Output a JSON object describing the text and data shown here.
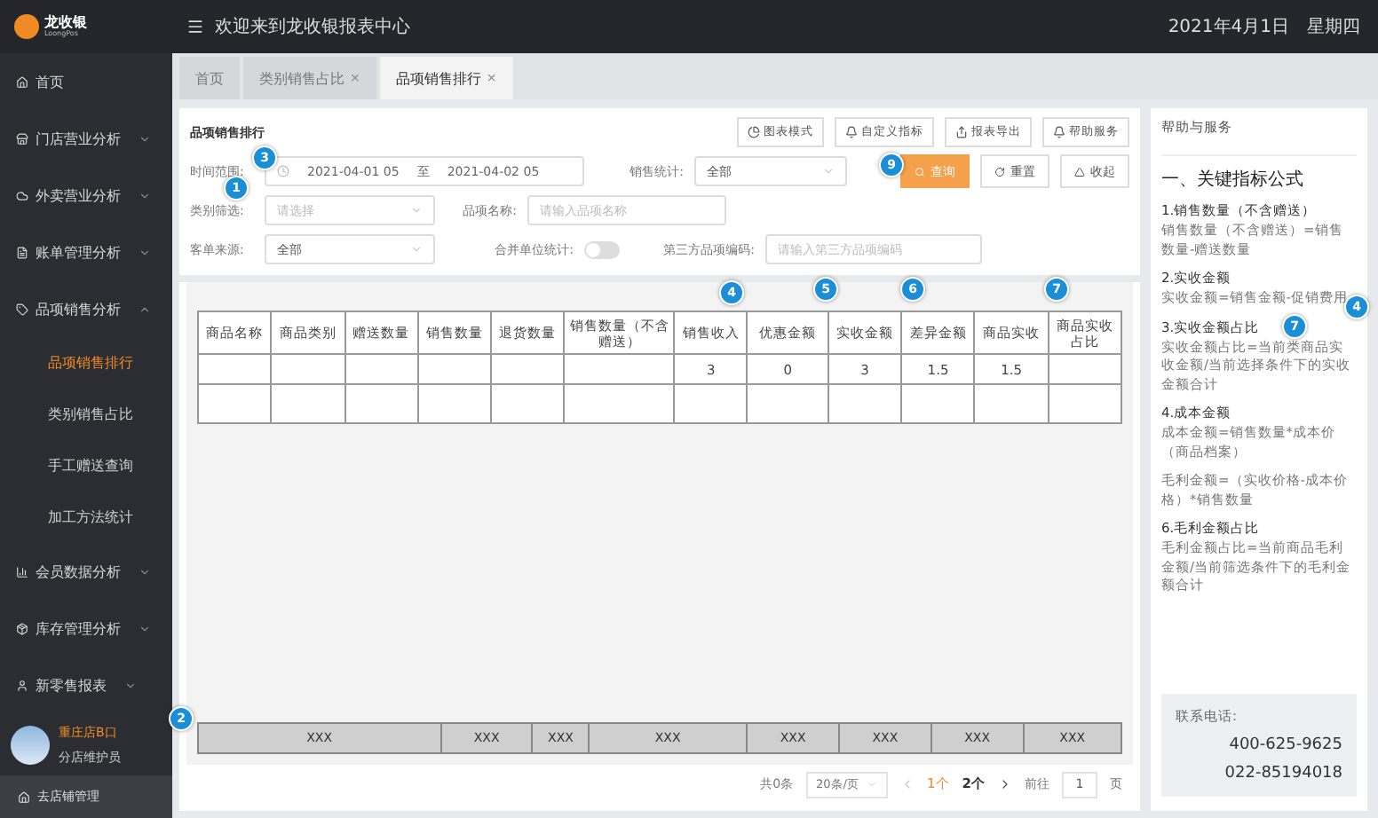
{
  "header": {
    "logo": "龙收银",
    "logo_sub": "LoongPos",
    "title": "欢迎来到龙收银报表中心",
    "date": "2021年4月1日",
    "weekday": "星期四"
  },
  "sidebar": {
    "items": [
      {
        "label": "首页"
      },
      {
        "label": "门店营业分析",
        "expanded": false
      },
      {
        "label": "外卖营业分析",
        "expanded": false
      },
      {
        "label": "账单管理分析",
        "expanded": false
      },
      {
        "label": "品项销售分析",
        "expanded": true,
        "children": [
          {
            "label": "品项销售排行",
            "selected": true
          },
          {
            "label": "类别销售占比",
            "selected": false
          },
          {
            "label": "手工赠送查询",
            "selected": false
          },
          {
            "label": "加工方法统计",
            "selected": false
          }
        ]
      },
      {
        "label": "会员数据分析",
        "expanded": false
      },
      {
        "label": "库存管理分析",
        "expanded": false
      },
      {
        "label": "新零售报表",
        "expanded": false
      }
    ],
    "user": {
      "name": "重庄店B口",
      "role": "分店维护员"
    },
    "footer_link": "去店铺管理"
  },
  "tabs": [
    {
      "label": "首页",
      "selected": false
    },
    {
      "label": "类别销售占比",
      "close": "×",
      "selected": false
    },
    {
      "label": "品项销售排行",
      "close": "×",
      "selected": true
    }
  ],
  "filters": {
    "title": "品项销售排行",
    "tool_buttons": [
      "图表模式",
      "自定义指标",
      "报表导出",
      "帮助服务"
    ],
    "time_label": "时间范围:",
    "date_start": "2021-04-01 05",
    "date_sep": "至",
    "date_end": "2021-04-02 05",
    "sales_label": "销售统计:",
    "sales_value": "全部",
    "actions": [
      {
        "label": "查询",
        "kind": "primary"
      },
      {
        "label": "重置",
        "kind": "default"
      },
      {
        "label": "收起",
        "kind": "default"
      }
    ],
    "category_label": "类别筛选:",
    "category_placeholder": "请选择",
    "item_label": "品项名称:",
    "item_placeholder": "请输入品项名称",
    "source_label": "客单来源:",
    "source_value": "全部",
    "merge_label": "合并单位统计:",
    "merge_on": false,
    "code_label": "第三方品项编码:",
    "code_placeholder": "请输入第三方品项编码"
  },
  "table": {
    "columns": [
      "商品名称",
      "商品类别",
      "赠送数量",
      "销售数量",
      "退货数量",
      "销售数量（不含赠送）",
      "销售收入",
      "优惠金额",
      "实收金额",
      "差异金额",
      "商品实收",
      "商品实收占比"
    ],
    "rows": [
      [
        "",
        "",
        "",
        "",
        "",
        "",
        "3",
        "0",
        "3",
        "1.5",
        "1.5",
        ""
      ],
      [
        "",
        "",
        "",
        "",
        "",
        "",
        "",
        "",
        "",
        "",
        "",
        ""
      ]
    ],
    "footer": [
      "XXX",
      "XXX",
      "XXX",
      "XXX",
      "XXX",
      "XXX",
      "XXX",
      "XXX"
    ]
  },
  "pagination": {
    "total": "共0条",
    "page_size": "20条/页",
    "pages": [
      {
        "label": "1个",
        "selected": true
      },
      {
        "label": "2个",
        "selected": false
      }
    ],
    "goto_label": "前往",
    "goto_value": "1",
    "goto_suffix": "页"
  },
  "help": {
    "title": "帮助与服务",
    "heading": "一、关键指标公式",
    "sections": [
      {
        "title": "1.销售数量（不含赠送）",
        "body": "销售数量（不含赠送）=销售数量-赠送数量"
      },
      {
        "title": "2.实收金额",
        "body": "实收金额=销售金额-促销费用"
      },
      {
        "title": "3.实收金额占比",
        "body": "实收金额占比=当前类商品实收金额/当前选择条件下的实收金额合计"
      },
      {
        "title": "4.成本金额",
        "body": "成本金额=销售数量*成本价（商品档案）"
      },
      {
        "body": "毛利金额=（实收价格-成本价格）*销售数量"
      },
      {
        "title": "6.毛利金额占比",
        "body": "毛利金额占比=当前商品毛利金额/当前筛选条件下的毛利金额合计"
      }
    ],
    "contact_label": "联系电话:",
    "phones": [
      "400-625-9625",
      "022-85194018"
    ]
  },
  "annotations": [
    "3",
    "1",
    "9",
    "4",
    "5",
    "6",
    "7",
    "2",
    "4",
    "7"
  ]
}
